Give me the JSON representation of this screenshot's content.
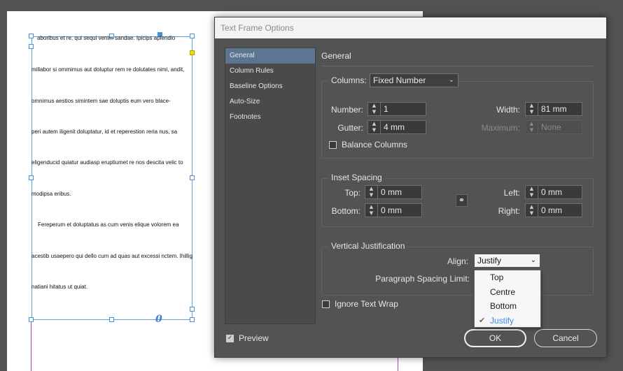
{
  "document": {
    "lines": [
      "aboribus et re, qui sequi venim sandae. Ipicips aplendio",
      "millabor si ommimus aut doluptur rem re dolutates nimi, andit,",
      "omnimus aestios simintem sae doluptis eum vero blace-",
      "peri autem iligenit doluptatur, id et reperestion reria nus, sa",
      "eligenducid quiatur audiasp eruptiumet re nos descita velic to",
      "modipsa eribus.",
      "Fereperum et doluptatus as cum venis elique volorem ea",
      "acestib usaepero qui dello cum ad quas aut excessi nctem. Ihillig",
      "natiani hitatus ut quiat."
    ],
    "overset_glyph": "0"
  },
  "dialog": {
    "title": "Text Frame Options",
    "sidebar": [
      {
        "label": "General"
      },
      {
        "label": "Column Rules"
      },
      {
        "label": "Baseline Options"
      },
      {
        "label": "Auto-Size"
      },
      {
        "label": "Footnotes"
      }
    ],
    "section_title": "General",
    "columns": {
      "label": "Columns:",
      "type_value": "Fixed Number",
      "number_label": "Number:",
      "number_value": "1",
      "gutter_label": "Gutter:",
      "gutter_value": "4 mm",
      "width_label": "Width:",
      "width_value": "81 mm",
      "maximum_label": "Maximum:",
      "maximum_value": "None",
      "balance_label": "Balance Columns",
      "balance_checked": false
    },
    "inset": {
      "title": "Inset Spacing",
      "top_label": "Top:",
      "top_value": "0 mm",
      "bottom_label": "Bottom:",
      "bottom_value": "0 mm",
      "left_label": "Left:",
      "left_value": "0 mm",
      "right_label": "Right:",
      "right_value": "0 mm"
    },
    "vertical": {
      "title": "Vertical Justification",
      "align_label": "Align:",
      "align_value": "Justify",
      "para_label": "Paragraph Spacing Limit:",
      "options": [
        "Top",
        "Centre",
        "Bottom",
        "Justify"
      ],
      "selected": "Justify"
    },
    "ignore_wrap_label": "Ignore Text Wrap",
    "preview_label": "Preview",
    "preview_checked": true,
    "ok_label": "OK",
    "cancel_label": "Cancel"
  },
  "colors": {
    "panel_bg": "#535353",
    "selection": "#5c7590",
    "frame_blue": "#5aa2e0",
    "dropdown_selected": "#3a8ee6"
  }
}
